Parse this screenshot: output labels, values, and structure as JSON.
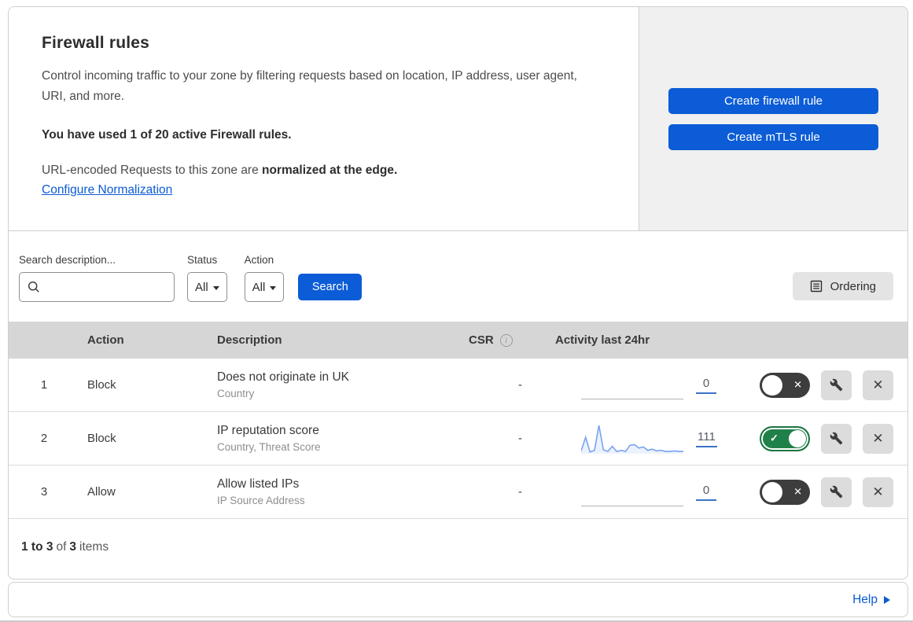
{
  "colors": {
    "accent_blue": "#0b5cd6",
    "link_blue": "#0b5bd3",
    "toggle_on_green": "#20804a",
    "toggle_off_gray": "#3d3d3d",
    "sparkline_blue": "#78a3ee",
    "table_header_gray": "#d6d6d6",
    "side_panel_gray": "#f0f0f0"
  },
  "header": {
    "title": "Firewall rules",
    "description": "Control incoming traffic to your zone by filtering requests based on location, IP address, user agent, URI, and more.",
    "usage_note": "You have used 1 of 20 active Firewall rules.",
    "normalization_text": "URL-encoded Requests to this zone are ",
    "normalization_bold": "normalized at the edge.",
    "normalization_link": "Configure Normalization",
    "create_firewall_button": "Create firewall rule",
    "create_mtls_button": "Create mTLS rule"
  },
  "filters": {
    "search_label": "Search description...",
    "search_value": "",
    "status_label": "Status",
    "status_value": "All",
    "action_label": "Action",
    "action_value": "All",
    "search_button": "Search",
    "ordering_button": "Ordering"
  },
  "table": {
    "headers": {
      "action": "Action",
      "description": "Description",
      "csr": "CSR",
      "activity": "Activity last 24hr"
    },
    "rows": [
      {
        "number": "1",
        "action": "Block",
        "description": "Does not originate in UK",
        "match_fields": "Country",
        "csr": "-",
        "activity_count": "0",
        "enabled": false,
        "sparkline": null
      },
      {
        "number": "2",
        "action": "Block",
        "description": "IP reputation score",
        "match_fields": "Country, Threat Score",
        "csr": "-",
        "activity_count": "111",
        "enabled": true,
        "sparkline": [
          10,
          58,
          6,
          12,
          100,
          14,
          8,
          26,
          8,
          12,
          8,
          30,
          32,
          20,
          24,
          12,
          16,
          10,
          12,
          8,
          8,
          10,
          8,
          8
        ]
      },
      {
        "number": "3",
        "action": "Allow",
        "description": "Allow listed IPs",
        "match_fields": "IP Source Address",
        "csr": "-",
        "activity_count": "0",
        "enabled": false,
        "sparkline": null
      }
    ],
    "summary": {
      "range": "1 to 3",
      "of_word": "of",
      "total": "3",
      "items_word": "items"
    }
  },
  "footer": {
    "help_label": "Help"
  }
}
